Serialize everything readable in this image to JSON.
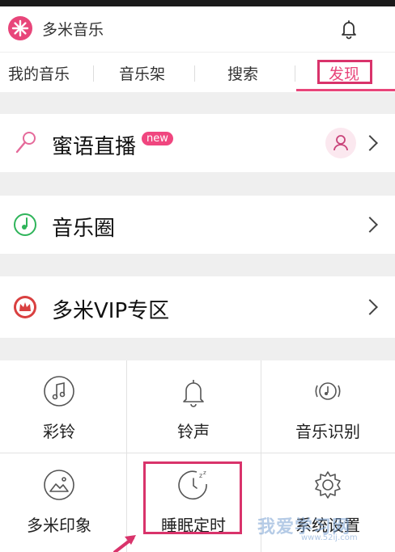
{
  "app": {
    "title": "多米音乐"
  },
  "tabs": [
    "我的音乐",
    "音乐架",
    "搜索",
    "发现"
  ],
  "active_tab": "发现",
  "rows": [
    {
      "label": "蜜语直播",
      "badge": "new",
      "icon": "microphone-icon",
      "right_icon": "user-icon"
    },
    {
      "label": "音乐圈",
      "icon": "music-circle-icon"
    },
    {
      "label": "多米VIP专区",
      "icon": "vip-crown-icon"
    }
  ],
  "grid": [
    {
      "label": "彩铃",
      "icon": "music-note-icon"
    },
    {
      "label": "铃声",
      "icon": "bell-icon"
    },
    {
      "label": "音乐识别",
      "icon": "music-recognition-icon"
    },
    {
      "label": "多米印象",
      "icon": "image-icon"
    },
    {
      "label": "睡眠定时",
      "icon": "sleep-timer-icon"
    },
    {
      "label": "系统设置",
      "icon": "gear-icon"
    }
  ],
  "watermark": {
    "text": "我爱学习网",
    "sub": "www.52ij.com"
  },
  "colors": {
    "accent": "#e8457a",
    "annotation": "#d9336b",
    "background": "#efefef"
  }
}
